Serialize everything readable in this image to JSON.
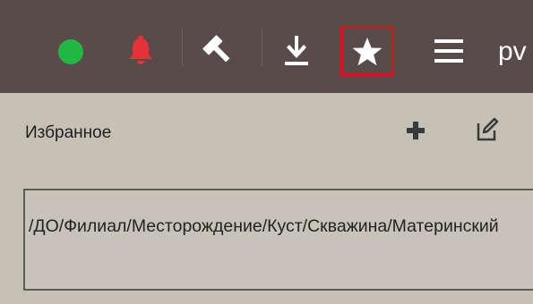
{
  "toolbar": {
    "icons": {
      "status": "green-circle-icon",
      "notifications": "bell-icon",
      "tools": "hammer-icon",
      "download": "download-icon",
      "favorites": "star-icon",
      "menu": "hamburger-icon"
    },
    "user_label": "pv"
  },
  "favorites": {
    "title": "Избранное",
    "add_icon": "plus-icon",
    "edit_icon": "edit-icon",
    "path_text": "/ДО/Филиал/Месторождение/Куст/Скважина/Материнский"
  },
  "colors": {
    "toolbar_bg": "#5a4b4b",
    "panel_bg": "#c6c1b5",
    "status_green": "#20b840",
    "bell_red": "#e8303a",
    "highlight_red": "#e0101a"
  }
}
